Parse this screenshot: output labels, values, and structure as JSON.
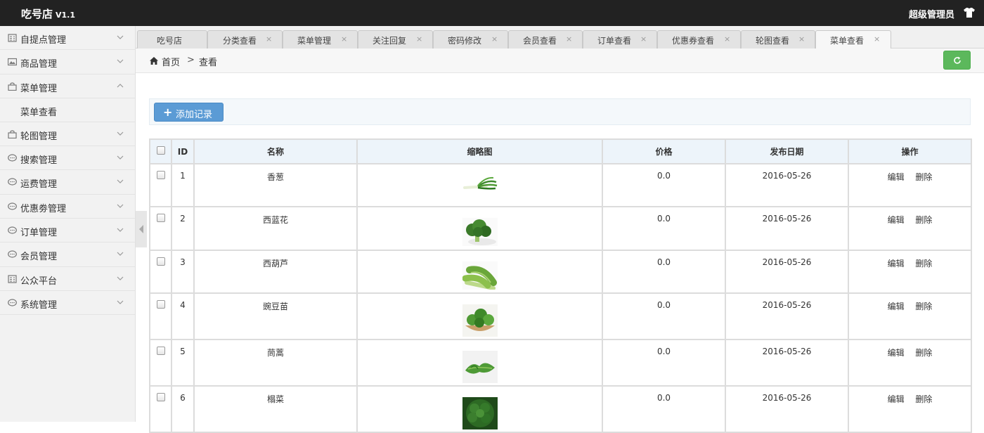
{
  "app": {
    "title": "吃号店",
    "version": "V1.1",
    "user": "超级管理员"
  },
  "sidebar": {
    "items": [
      {
        "label": "自提点管理",
        "icon": "building-icon",
        "expanded": false
      },
      {
        "label": "商品管理",
        "icon": "image-icon",
        "expanded": false
      },
      {
        "label": "菜单管理",
        "icon": "bag-icon",
        "expanded": true,
        "children": [
          {
            "label": "菜单查看"
          }
        ]
      },
      {
        "label": "轮图管理",
        "icon": "bag-icon",
        "expanded": false
      },
      {
        "label": "搜索管理",
        "icon": "chat-icon",
        "expanded": false
      },
      {
        "label": "运费管理",
        "icon": "chat-icon",
        "expanded": false
      },
      {
        "label": "优惠劵管理",
        "icon": "chat-icon",
        "expanded": false
      },
      {
        "label": "订单管理",
        "icon": "chat-icon",
        "expanded": false
      },
      {
        "label": "会员管理",
        "icon": "chat-icon",
        "expanded": false
      },
      {
        "label": "公众平台",
        "icon": "building-icon",
        "expanded": false
      },
      {
        "label": "系统管理",
        "icon": "chat-icon",
        "expanded": false
      }
    ]
  },
  "tabs": [
    {
      "label": "吃号店",
      "closable": false
    },
    {
      "label": "分类查看",
      "closable": true
    },
    {
      "label": "菜单管理",
      "closable": true
    },
    {
      "label": "关注回复",
      "closable": true
    },
    {
      "label": "密码修改",
      "closable": true
    },
    {
      "label": "会员查看",
      "closable": true
    },
    {
      "label": "订单查看",
      "closable": true
    },
    {
      "label": "优惠券查看",
      "closable": true
    },
    {
      "label": "轮图查看",
      "closable": true
    },
    {
      "label": "菜单查看",
      "closable": true,
      "active": true
    }
  ],
  "close_glyph": "×",
  "breadcrumb": {
    "home": "首页",
    "separator": ">",
    "current": "查看"
  },
  "toolbar": {
    "add_label": "添加记录",
    "add_icon": "+"
  },
  "table": {
    "columns": [
      "ID",
      "名称",
      "缩略图",
      "价格",
      "发布日期",
      "操作"
    ],
    "actions": {
      "edit": "编辑",
      "delete": "删除"
    },
    "rows": [
      {
        "id": "1",
        "name": "香葱",
        "price": "0.0",
        "date": "2016-05-26",
        "thumb": "scallion"
      },
      {
        "id": "2",
        "name": "西蓝花",
        "price": "0.0",
        "date": "2016-05-26",
        "thumb": "broccoli"
      },
      {
        "id": "3",
        "name": "西葫芦",
        "price": "0.0",
        "date": "2016-05-26",
        "thumb": "zucchini"
      },
      {
        "id": "4",
        "name": "豌豆苗",
        "price": "0.0",
        "date": "2016-05-26",
        "thumb": "pea-shoots"
      },
      {
        "id": "5",
        "name": "茼蒿",
        "price": "0.0",
        "date": "2016-05-26",
        "thumb": "crown-daisy"
      },
      {
        "id": "6",
        "name": "榻菜",
        "price": "0.0",
        "date": "2016-05-26",
        "thumb": "tatsoi"
      }
    ]
  },
  "colors": {
    "topbar": "#222222",
    "primary": "#5b9bd5",
    "success": "#5cb85c",
    "header_bg": "#edf4fa"
  }
}
